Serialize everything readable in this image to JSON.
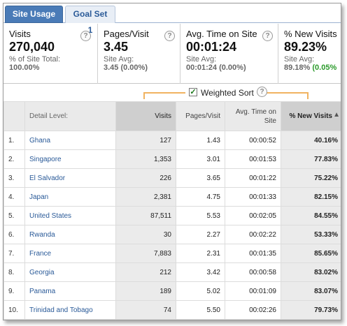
{
  "tabs": [
    {
      "label": "Site Usage",
      "active": true
    },
    {
      "label": "Goal Set 1",
      "active": false
    }
  ],
  "metrics": [
    {
      "label": "Visits",
      "value": "270,040",
      "sub_label": "% of Site Total:",
      "sub_value": "100.00%",
      "sub_delta": ""
    },
    {
      "label": "Pages/Visit",
      "value": "3.45",
      "sub_label": "Site Avg:",
      "sub_value": "3.45 (0.00%)",
      "sub_delta": ""
    },
    {
      "label": "Avg. Time on Site",
      "value": "00:01:24",
      "sub_label": "Site Avg:",
      "sub_value": "00:01:24 (0.00%)",
      "sub_delta": ""
    },
    {
      "label": "% New Visits",
      "value": "89.23%",
      "sub_label": "Site Avg:",
      "sub_value": "89.18% ",
      "sub_delta": "(0.05%"
    }
  ],
  "help_icon": "question-mark",
  "weighted_sort": {
    "label": "Weighted Sort",
    "checked": true,
    "checkmark": "✓"
  },
  "table": {
    "columns": {
      "detail": "Detail Level:",
      "visits": "Visits",
      "pages": "Pages/Visit",
      "time": "Avg. Time on Site",
      "new": "% New Visits"
    },
    "rows": [
      {
        "idx": "1.",
        "name": "Ghana",
        "visits": "127",
        "pages": "1.43",
        "time": "00:00:52",
        "new": "40.16%"
      },
      {
        "idx": "2.",
        "name": "Singapore",
        "visits": "1,353",
        "pages": "3.01",
        "time": "00:01:53",
        "new": "77.83%"
      },
      {
        "idx": "3.",
        "name": "El Salvador",
        "visits": "226",
        "pages": "3.65",
        "time": "00:01:22",
        "new": "75.22%"
      },
      {
        "idx": "4.",
        "name": "Japan",
        "visits": "2,381",
        "pages": "4.75",
        "time": "00:01:33",
        "new": "82.15%"
      },
      {
        "idx": "5.",
        "name": "United States",
        "visits": "87,511",
        "pages": "5.53",
        "time": "00:02:05",
        "new": "84.55%"
      },
      {
        "idx": "6.",
        "name": "Rwanda",
        "visits": "30",
        "pages": "2.27",
        "time": "00:02:22",
        "new": "53.33%"
      },
      {
        "idx": "7.",
        "name": "France",
        "visits": "7,883",
        "pages": "2.31",
        "time": "00:01:35",
        "new": "85.65%"
      },
      {
        "idx": "8.",
        "name": "Georgia",
        "visits": "212",
        "pages": "3.42",
        "time": "00:00:58",
        "new": "83.02%"
      },
      {
        "idx": "9.",
        "name": "Panama",
        "visits": "189",
        "pages": "5.02",
        "time": "00:01:09",
        "new": "83.07%"
      },
      {
        "idx": "10.",
        "name": "Trinidad and Tobago",
        "visits": "74",
        "pages": "5.50",
        "time": "00:02:26",
        "new": "79.73%"
      }
    ]
  }
}
